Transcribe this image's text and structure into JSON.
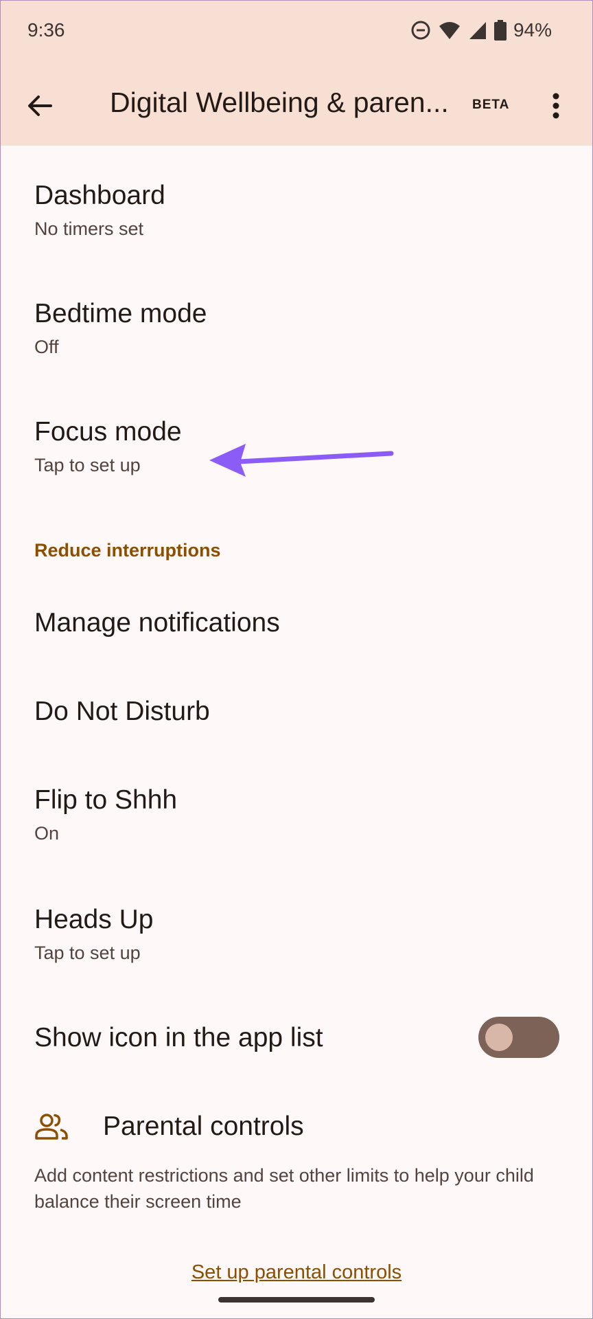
{
  "status_bar": {
    "time": "9:36",
    "battery_percent": "94%",
    "icons": [
      "dnd-icon",
      "wifi-icon",
      "cell-signal-icon",
      "battery-icon"
    ]
  },
  "app_bar": {
    "title": "Digital Wellbeing & paren...",
    "badge": "BETA"
  },
  "items": [
    {
      "title": "Dashboard",
      "subtitle": "No timers set"
    },
    {
      "title": "Bedtime mode",
      "subtitle": "Off"
    },
    {
      "title": "Focus mode",
      "subtitle": "Tap to set up"
    },
    {
      "title": "Manage notifications"
    },
    {
      "title": "Do Not Disturb"
    },
    {
      "title": "Flip to Shhh",
      "subtitle": "On"
    },
    {
      "title": "Heads Up",
      "subtitle": "Tap to set up"
    },
    {
      "title": "Show icon in the app list",
      "toggle_on": false
    }
  ],
  "section_header": "Reduce interruptions",
  "parental": {
    "title": "Parental controls",
    "description": "Add content restrictions and set other limits to help your child balance their screen time",
    "link": "Set up parental controls"
  },
  "colors": {
    "top_bar": "#F8DFD3",
    "background": "#FFF8F8",
    "accent": "#8E4E00",
    "annotation_arrow": "#8B5CF6",
    "toggle_track": "#7D6257"
  }
}
